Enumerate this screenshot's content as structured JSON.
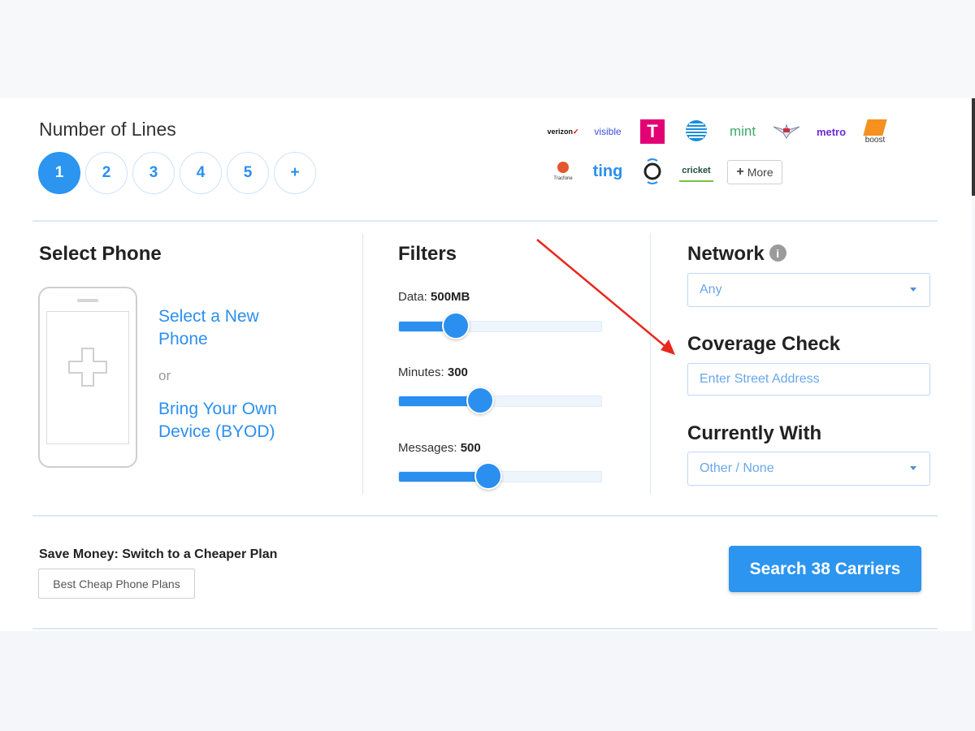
{
  "lines": {
    "title": "Number of Lines",
    "options": [
      "1",
      "2",
      "3",
      "4",
      "5",
      "+"
    ],
    "selected": "1"
  },
  "carriers": {
    "row1": [
      "verizon",
      "visible",
      "T",
      "AT&T",
      "mint",
      "US Mobile",
      "metro",
      "boost"
    ],
    "row2": [
      "Tracfone",
      "ting",
      "Xfinity",
      "cricket"
    ],
    "more_label": "More"
  },
  "select_phone": {
    "title": "Select Phone",
    "new_phone_label": "Select a New Phone",
    "or_label": "or",
    "byod_label": "Bring Your Own Device (BYOD)"
  },
  "filters": {
    "title": "Filters",
    "data": {
      "label": "Data:",
      "value": "500MB",
      "fraction": 0.28
    },
    "minutes": {
      "label": "Minutes:",
      "value": "300",
      "fraction": 0.4
    },
    "messages": {
      "label": "Messages:",
      "value": "500",
      "fraction": 0.44
    }
  },
  "network": {
    "title": "Network",
    "selected": "Any"
  },
  "coverage": {
    "title": "Coverage Check",
    "placeholder": "Enter Street Address"
  },
  "current": {
    "title": "Currently With",
    "selected": "Other / None"
  },
  "footer": {
    "save_title": "Save Money: Switch to a Cheaper Plan",
    "cheap_button": "Best Cheap Phone Plans",
    "search_button": "Search 38 Carriers"
  },
  "colors": {
    "accent": "#2b95f0",
    "annotation_arrow": "#e8281e"
  }
}
